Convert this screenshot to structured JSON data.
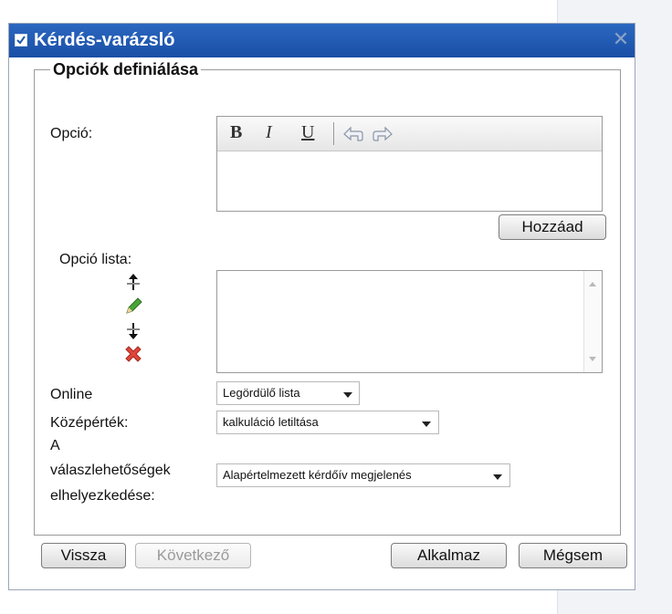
{
  "dialog": {
    "title": "Kérdés-varázsló",
    "close_glyph": "✕"
  },
  "section": {
    "legend": "Opciók definiálása",
    "option_label": "Opció:",
    "editor_toolbar": {
      "bold": "B",
      "italic": "I",
      "underline": "U",
      "undo_icon": "undo-icon",
      "redo_icon": "redo-icon"
    },
    "add_button": "Hozzáad",
    "option_list_label": "Opció lista:",
    "list_icons": [
      "move-up-icon",
      "edit-pencil-icon",
      "move-down-icon",
      "delete-icon"
    ],
    "online_label": "Online",
    "online_select": "Legördülő lista",
    "middle_label": "Középérték:",
    "middle_select": "kalkuláció letiltása",
    "position_label_lines": [
      "A",
      "válaszlehetőségek",
      "elhelyezkedése:"
    ],
    "position_select": "Alapértelmezett kérdőív megjelenés"
  },
  "footer": {
    "back": "Vissza",
    "next": "Következő",
    "apply": "Alkalmaz",
    "cancel": "Mégsem"
  },
  "colors": {
    "titlebar": "#1f58b0",
    "delete_icon": "#e0453a",
    "edit_icon": "#4aa33a"
  }
}
